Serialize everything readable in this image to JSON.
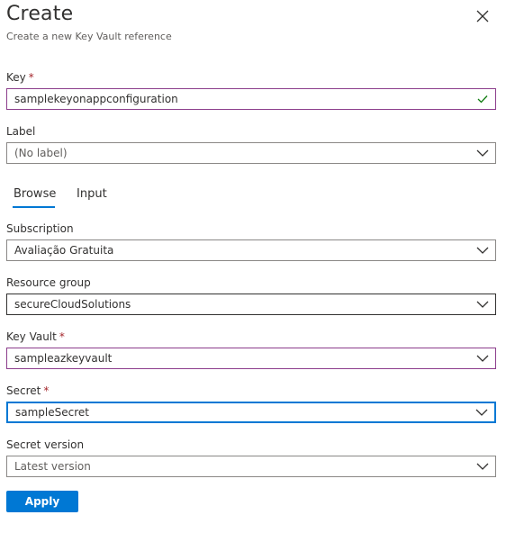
{
  "header": {
    "title": "Create",
    "subtitle": "Create a new Key Vault reference"
  },
  "key": {
    "label": "Key",
    "required": "*",
    "value": "samplekeyonappconfiguration"
  },
  "label_field": {
    "label": "Label",
    "value": "(No label)"
  },
  "tabs": [
    {
      "label": "Browse",
      "selected": true
    },
    {
      "label": "Input",
      "selected": false
    }
  ],
  "subscription": {
    "label": "Subscription",
    "value": "Avaliação Gratuita"
  },
  "resource_group": {
    "label": "Resource group",
    "value": "secureCloudSolutions"
  },
  "key_vault": {
    "label": "Key Vault",
    "required": "*",
    "value": "sampleazkeyvault"
  },
  "secret": {
    "label": "Secret",
    "required": "*",
    "value": "sampleSecret"
  },
  "secret_version": {
    "label": "Secret version",
    "value": "Latest version"
  },
  "actions": {
    "apply_label": "Apply"
  },
  "colors": {
    "accent": "#0078d4",
    "required": "#a4262c",
    "valid": "#107c10"
  }
}
